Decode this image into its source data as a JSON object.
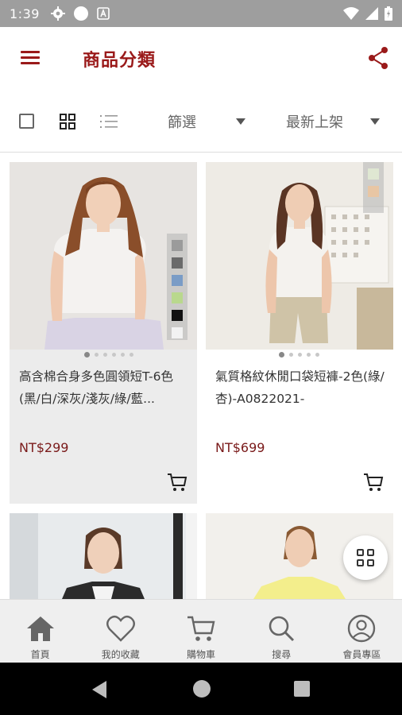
{
  "status_bar": {
    "time": "1:39",
    "icons": [
      "gear-icon",
      "circle-icon",
      "a-icon",
      "wifi-icon",
      "signal-icon",
      "battery-icon"
    ]
  },
  "header": {
    "title": "商品分類",
    "title_color": "#9a1a1a",
    "icons": [
      "hamburger-menu-icon",
      "share-icon"
    ]
  },
  "toolbar": {
    "filter_label": "篩選",
    "sort_label": "最新上架",
    "icons": [
      "select-checkbox",
      "grid-view-icon",
      "list-view-icon",
      "caret-down-icon"
    ]
  },
  "products": [
    {
      "name": "高含棉合身多色圓領短T-6色(黑/白/深灰/淺灰/綠/藍...",
      "price": "NT$299",
      "swatches": [
        "#9b9b9b",
        "#6a6a6a",
        "#7a9cc6",
        "#b9d88d",
        "#111111",
        "#f2f2f2"
      ],
      "image_pages": 6,
      "current_page": 1
    },
    {
      "name": "氣質格紋休閒口袋短褲-2色(綠/杏)-A0822021-",
      "price": "NT$699",
      "swatches": [
        "#dfe7d2",
        "#e8c6a4"
      ],
      "image_pages": 5,
      "current_page": 1
    },
    {
      "name": "",
      "price": ""
    },
    {
      "name": "",
      "price": ""
    }
  ],
  "accent_price_color": "#7a1a1a",
  "tabs": [
    {
      "label": "首頁",
      "icon": "home-icon"
    },
    {
      "label": "我的收藏",
      "icon": "heart-icon"
    },
    {
      "label": "購物車",
      "icon": "cart-icon"
    },
    {
      "label": "搜尋",
      "icon": "search-icon"
    },
    {
      "label": "會員專區",
      "icon": "member-icon"
    }
  ],
  "system_nav": [
    "back-icon",
    "home-circle-icon",
    "recents-icon"
  ]
}
